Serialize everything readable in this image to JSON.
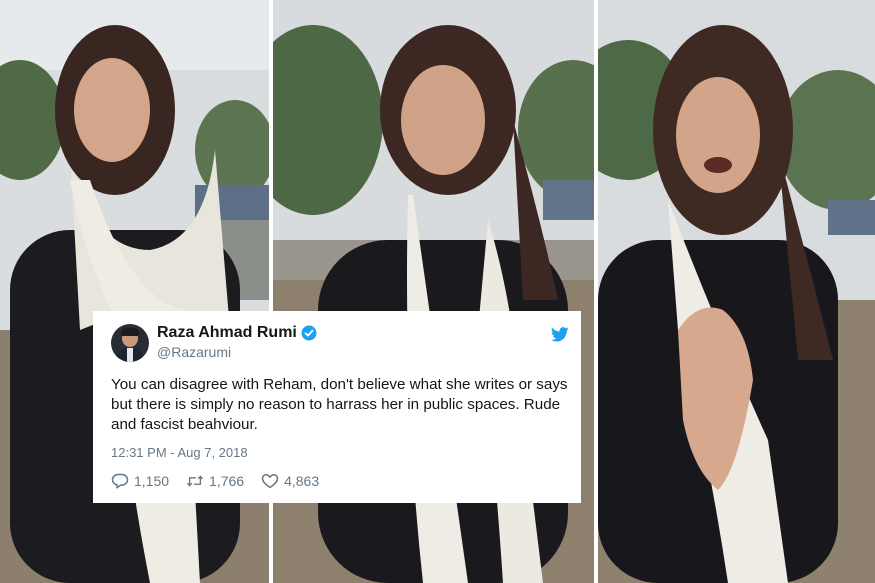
{
  "tweet": {
    "display_name": "Raza Ahmad Rumi",
    "handle": "@Razarumi",
    "text": "You can disagree with Reham, don't believe what she writes or says but there is simply no reason to harrass her in public spaces. Rude and fascist beahviour.",
    "timestamp": "12:31 PM - Aug 7, 2018",
    "replies": "1,150",
    "retweets": "1,766",
    "likes": "4,863",
    "icons": [
      "verified-badge-icon",
      "twitter-bird-icon",
      "reply-icon",
      "retweet-icon",
      "like-icon"
    ],
    "colors": {
      "brand": "#1da1f2",
      "secondary_text": "#657786",
      "primary_text": "#14171a"
    }
  }
}
